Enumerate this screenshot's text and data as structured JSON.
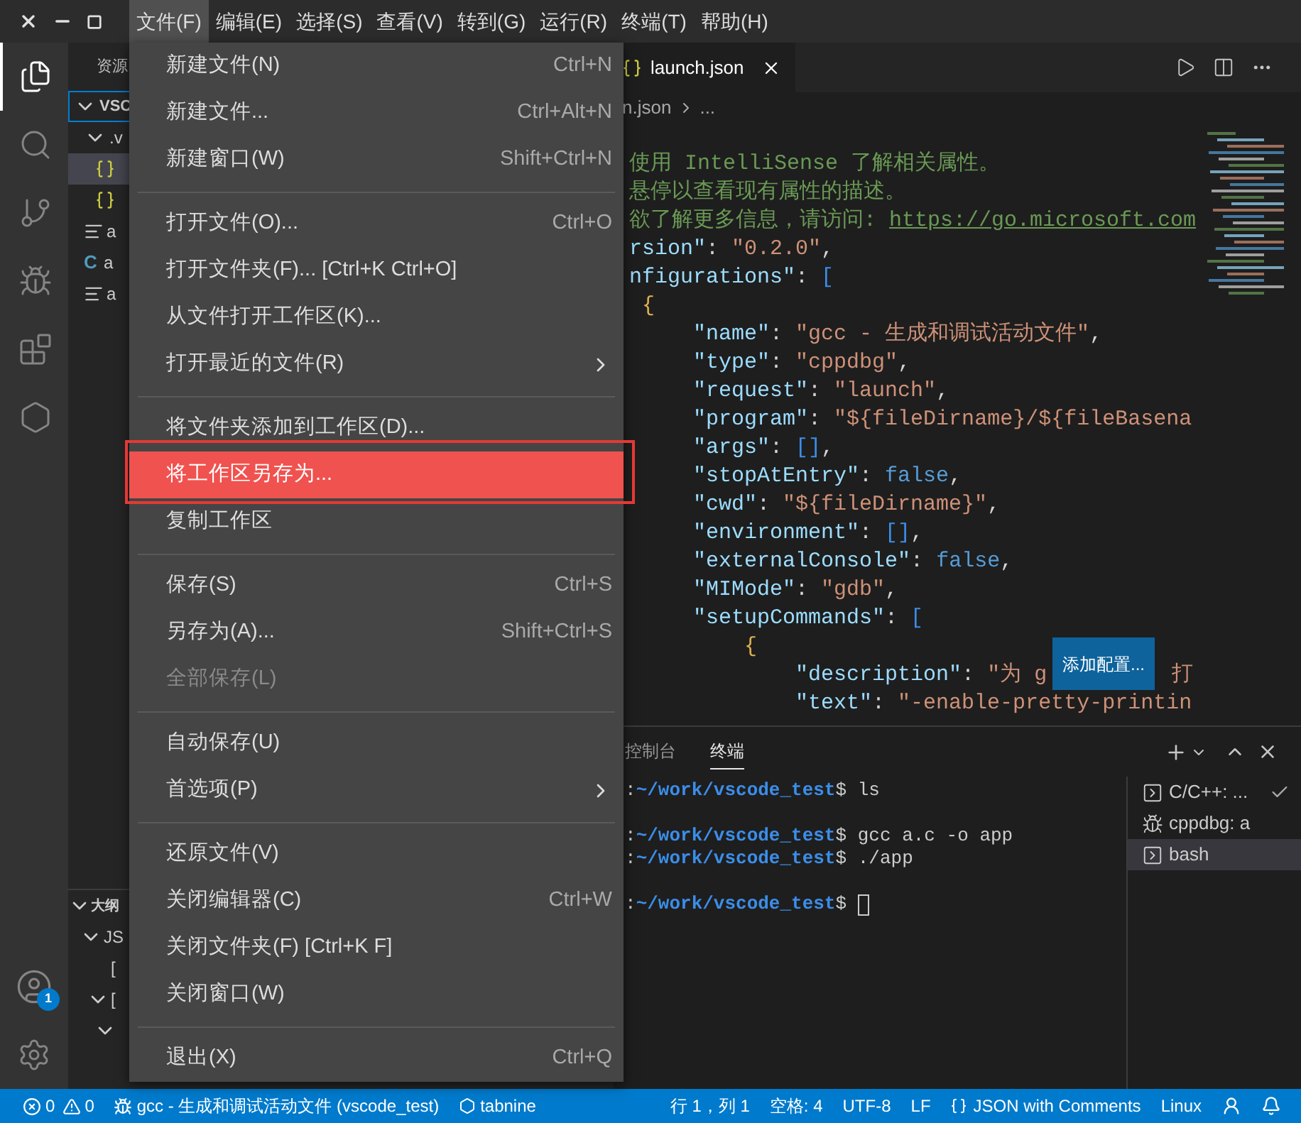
{
  "menu_bar": [
    {
      "label": "文件(F)",
      "selected": true
    },
    {
      "label": "编辑(E)",
      "selected": false
    },
    {
      "label": "选择(S)",
      "selected": false
    },
    {
      "label": "查看(V)",
      "selected": false
    },
    {
      "label": "转到(G)",
      "selected": false
    },
    {
      "label": "运行(R)",
      "selected": false
    },
    {
      "label": "终端(T)",
      "selected": false
    },
    {
      "label": "帮助(H)",
      "selected": false
    }
  ],
  "activity_bar": [
    {
      "selected": true
    },
    {
      "selected": false
    },
    {
      "selected": false
    },
    {
      "selected": false
    },
    {
      "selected": false
    },
    {
      "selected": false
    }
  ],
  "account_badge": "1",
  "sidebar": {
    "title": "资源",
    "items": [
      {
        "kind": "folder",
        "label": "VSC",
        "expanded": true,
        "selected": true,
        "children": [
          {
            "kind": "folder",
            "label": ".v",
            "expanded": true,
            "selected": false,
            "children": [
              {
                "kind": "json",
                "selected": true
              },
              {
                "kind": "json",
                "selected": false
              }
            ]
          },
          {
            "kind": "text",
            "label": "a",
            "selected": false
          },
          {
            "kind": "c",
            "glyph": "C",
            "label": "a",
            "selected": false
          },
          {
            "kind": "text",
            "label": "a",
            "selected": false
          }
        ]
      }
    ]
  },
  "outline": {
    "title": "大纲",
    "expanded": true,
    "items": [
      {
        "label": "JS",
        "expanded": true,
        "children": [
          {
            "label": "["
          },
          {
            "label": "[",
            "expanded": true,
            "children": [
              {
                "expanded": true
              }
            ]
          }
        ]
      }
    ]
  },
  "file_menu": [
    {
      "kind": "item",
      "label": "新建文件(N)",
      "shortcut": "Ctrl+N",
      "selected": false,
      "disabled": false
    },
    {
      "kind": "item",
      "label": "新建文件...",
      "shortcut": "Ctrl+Alt+N",
      "selected": false,
      "disabled": false
    },
    {
      "kind": "item",
      "label": "新建窗口(W)",
      "shortcut": "Shift+Ctrl+N",
      "selected": false,
      "disabled": false
    },
    {
      "kind": "separator"
    },
    {
      "kind": "item",
      "label": "打开文件(O)...",
      "shortcut": "Ctrl+O",
      "selected": false,
      "disabled": false
    },
    {
      "kind": "item",
      "label": "打开文件夹(F)... [Ctrl+K Ctrl+O]",
      "selected": false,
      "disabled": false
    },
    {
      "kind": "item",
      "label": "从文件打开工作区(K)...",
      "selected": false,
      "disabled": false
    },
    {
      "kind": "item",
      "label": "打开最近的文件(R)",
      "submenu": true,
      "selected": false,
      "disabled": false
    },
    {
      "kind": "separator"
    },
    {
      "kind": "item",
      "label": "将文件夹添加到工作区(D)...",
      "selected": false,
      "disabled": false
    },
    {
      "kind": "item",
      "label": "将工作区另存为...",
      "selected": true,
      "disabled": false
    },
    {
      "kind": "item",
      "label": "复制工作区",
      "selected": false,
      "disabled": false
    },
    {
      "kind": "separator"
    },
    {
      "kind": "item",
      "label": "保存(S)",
      "shortcut": "Ctrl+S",
      "selected": false,
      "disabled": false
    },
    {
      "kind": "item",
      "label": "另存为(A)...",
      "shortcut": "Shift+Ctrl+S",
      "selected": false,
      "disabled": false
    },
    {
      "kind": "item",
      "label": "全部保存(L)",
      "selected": false,
      "disabled": true
    },
    {
      "kind": "separator"
    },
    {
      "kind": "item",
      "label": "自动保存(U)",
      "selected": false,
      "disabled": false
    },
    {
      "kind": "item",
      "label": "首选项(P)",
      "submenu": true,
      "selected": false,
      "disabled": false
    },
    {
      "kind": "separator"
    },
    {
      "kind": "item",
      "label": "还原文件(V)",
      "selected": false,
      "disabled": false
    },
    {
      "kind": "item",
      "label": "关闭编辑器(C)",
      "shortcut": "Ctrl+W",
      "selected": false,
      "disabled": false
    },
    {
      "kind": "item",
      "label": "关闭文件夹(F) [Ctrl+K F]",
      "selected": false,
      "disabled": false
    },
    {
      "kind": "item",
      "label": "关闭窗口(W)",
      "selected": false,
      "disabled": false
    },
    {
      "kind": "separator"
    },
    {
      "kind": "item",
      "label": "退出(X)",
      "shortcut": "Ctrl+Q",
      "selected": false,
      "disabled": false
    }
  ],
  "editor": {
    "tab": {
      "label": "launch.json",
      "selected": true
    },
    "breadcrumb": [
      "n.json",
      "..."
    ],
    "lines": [
      [
        {
          "kind": "comment",
          "text": "使用 IntelliSense 了解相关属性。"
        }
      ],
      [
        {
          "kind": "comment",
          "text": "悬停以查看现有属性的描述。"
        }
      ],
      [
        {
          "kind": "comment",
          "text": "欲了解更多信息，请访问: "
        },
        {
          "kind": "link",
          "text": "https://go.microsoft.com"
        }
      ],
      [
        {
          "kind": "key",
          "text": "rsion\""
        },
        {
          "kind": "punct",
          "text": ": "
        },
        {
          "kind": "string",
          "text": "\"0.2.0\""
        },
        {
          "kind": "punct",
          "text": ","
        }
      ],
      [
        {
          "kind": "key",
          "text": "nfigurations\""
        },
        {
          "kind": "punct",
          "text": ": "
        },
        {
          "kind": "square",
          "text": "["
        }
      ],
      [
        {
          "kind": "brace",
          "text": " {"
        }
      ],
      [
        {
          "kind": "key",
          "text": "     \"name\""
        },
        {
          "kind": "punct",
          "text": ": "
        },
        {
          "kind": "string",
          "text": "\"gcc - 生成和调试活动文件\""
        },
        {
          "kind": "punct",
          "text": ","
        }
      ],
      [
        {
          "kind": "key",
          "text": "     \"type\""
        },
        {
          "kind": "punct",
          "text": ": "
        },
        {
          "kind": "string",
          "text": "\"cppdbg\""
        },
        {
          "kind": "punct",
          "text": ","
        }
      ],
      [
        {
          "kind": "key",
          "text": "     \"request\""
        },
        {
          "kind": "punct",
          "text": ": "
        },
        {
          "kind": "string",
          "text": "\"launch\""
        },
        {
          "kind": "punct",
          "text": ","
        }
      ],
      [
        {
          "kind": "key",
          "text": "     \"program\""
        },
        {
          "kind": "punct",
          "text": ": "
        },
        {
          "kind": "string",
          "text": "\"${fileDirname}/${fileBasena"
        }
      ],
      [
        {
          "kind": "key",
          "text": "     \"args\""
        },
        {
          "kind": "punct",
          "text": ": "
        },
        {
          "kind": "square",
          "text": "[]"
        },
        {
          "kind": "punct",
          "text": ","
        }
      ],
      [
        {
          "kind": "key",
          "text": "     \"stopAtEntry\""
        },
        {
          "kind": "punct",
          "text": ": "
        },
        {
          "kind": "keyword",
          "text": "false"
        },
        {
          "kind": "punct",
          "text": ","
        }
      ],
      [
        {
          "kind": "key",
          "text": "     \"cwd\""
        },
        {
          "kind": "punct",
          "text": ": "
        },
        {
          "kind": "string",
          "text": "\"${fileDirname}\""
        },
        {
          "kind": "punct",
          "text": ","
        }
      ],
      [
        {
          "kind": "key",
          "text": "     \"environment\""
        },
        {
          "kind": "punct",
          "text": ": "
        },
        {
          "kind": "square",
          "text": "[]"
        },
        {
          "kind": "punct",
          "text": ","
        }
      ],
      [
        {
          "kind": "key",
          "text": "     \"externalConsole\""
        },
        {
          "kind": "punct",
          "text": ": "
        },
        {
          "kind": "keyword",
          "text": "false"
        },
        {
          "kind": "punct",
          "text": ","
        }
      ],
      [
        {
          "kind": "key",
          "text": "     \"MIMode\""
        },
        {
          "kind": "punct",
          "text": ": "
        },
        {
          "kind": "string",
          "text": "\"gdb\""
        },
        {
          "kind": "punct",
          "text": ","
        }
      ],
      [
        {
          "kind": "key",
          "text": "     \"setupCommands\""
        },
        {
          "kind": "punct",
          "text": ": "
        },
        {
          "kind": "square",
          "text": "["
        }
      ],
      [
        {
          "kind": "brace",
          "text": "         {"
        }
      ],
      [
        {
          "kind": "key",
          "text": "             \"description\""
        },
        {
          "kind": "punct",
          "text": ": "
        },
        {
          "kind": "string",
          "text": "\"为 g"
        },
        {
          "kind": "string",
          "text": "打",
          "after_overlay": true
        }
      ],
      [
        {
          "kind": "key",
          "text": "             \"text\""
        },
        {
          "kind": "punct",
          "text": ": "
        },
        {
          "kind": "string",
          "text": "\"-enable-pretty-printin"
        }
      ]
    ],
    "overlay_button": "添加配置..."
  },
  "panel": {
    "tabs": [
      {
        "label": "控制台",
        "selected": false
      },
      {
        "label": "终端",
        "selected": true
      }
    ],
    "terminal_lines": [
      {
        "kind": "prompt",
        "prefix": ":",
        "path": "~/work/vscode_test",
        "symbol": "$",
        "command": "ls"
      },
      {
        "kind": "blank"
      },
      {
        "kind": "prompt",
        "prefix": ":",
        "path": "~/work/vscode_test",
        "symbol": "$",
        "command": "gcc a.c -o app"
      },
      {
        "kind": "prompt",
        "prefix": ":",
        "path": "~/work/vscode_test",
        "symbol": "$",
        "command": "./app"
      },
      {
        "kind": "blank"
      },
      {
        "kind": "prompt",
        "prefix": ":",
        "path": "~/work/vscode_test",
        "symbol": "$",
        "cursor": true
      }
    ],
    "terminals": [
      {
        "kind": "task",
        "label": "C/C++: ...",
        "checked": true,
        "selected": false
      },
      {
        "kind": "debug",
        "label": "cppdbg: a",
        "checked": false,
        "selected": false
      },
      {
        "kind": "shell",
        "label": "bash",
        "checked": false,
        "selected": true
      }
    ]
  },
  "status_bar": {
    "errors": "0",
    "warnings": "0",
    "launch": "gcc - 生成和调试活动文件 (vscode_test)",
    "tabnine": "tabnine",
    "items": [
      "行 1，列 1",
      "空格: 4",
      "UTF-8",
      "LF"
    ],
    "language": "JSON with Comments",
    "os": "Linux"
  }
}
